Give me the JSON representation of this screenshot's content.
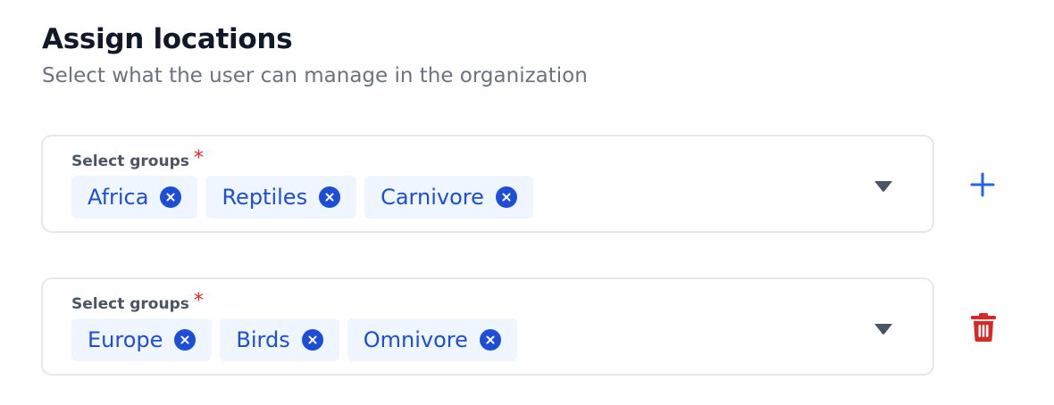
{
  "header": {
    "title": "Assign locations",
    "subtitle": "Select what the user can manage in the organization"
  },
  "groups": [
    {
      "label": "Select groups",
      "required_marker": "*",
      "chips": [
        {
          "label": "Africa",
          "remove_icon": "close-circle-icon"
        },
        {
          "label": "Reptiles",
          "remove_icon": "close-circle-icon"
        },
        {
          "label": "Carnivore",
          "remove_icon": "close-circle-icon"
        }
      ],
      "dropdown_icon": "caret-down-icon",
      "action_icon": "plus-icon"
    },
    {
      "label": "Select groups",
      "required_marker": "*",
      "chips": [
        {
          "label": "Europe",
          "remove_icon": "close-circle-icon"
        },
        {
          "label": "Birds",
          "remove_icon": "close-circle-icon"
        },
        {
          "label": "Omnivore",
          "remove_icon": "close-circle-icon"
        }
      ],
      "dropdown_icon": "caret-down-icon",
      "action_icon": "trash-icon"
    }
  ],
  "colors": {
    "chip_text": "#1d4ed8",
    "chip_background": "#eff6ff",
    "required": "#dc2626",
    "add_icon": "#2563eb",
    "delete_icon": "#dc2626",
    "caret": "#4b5563",
    "border": "#e5e7eb"
  }
}
